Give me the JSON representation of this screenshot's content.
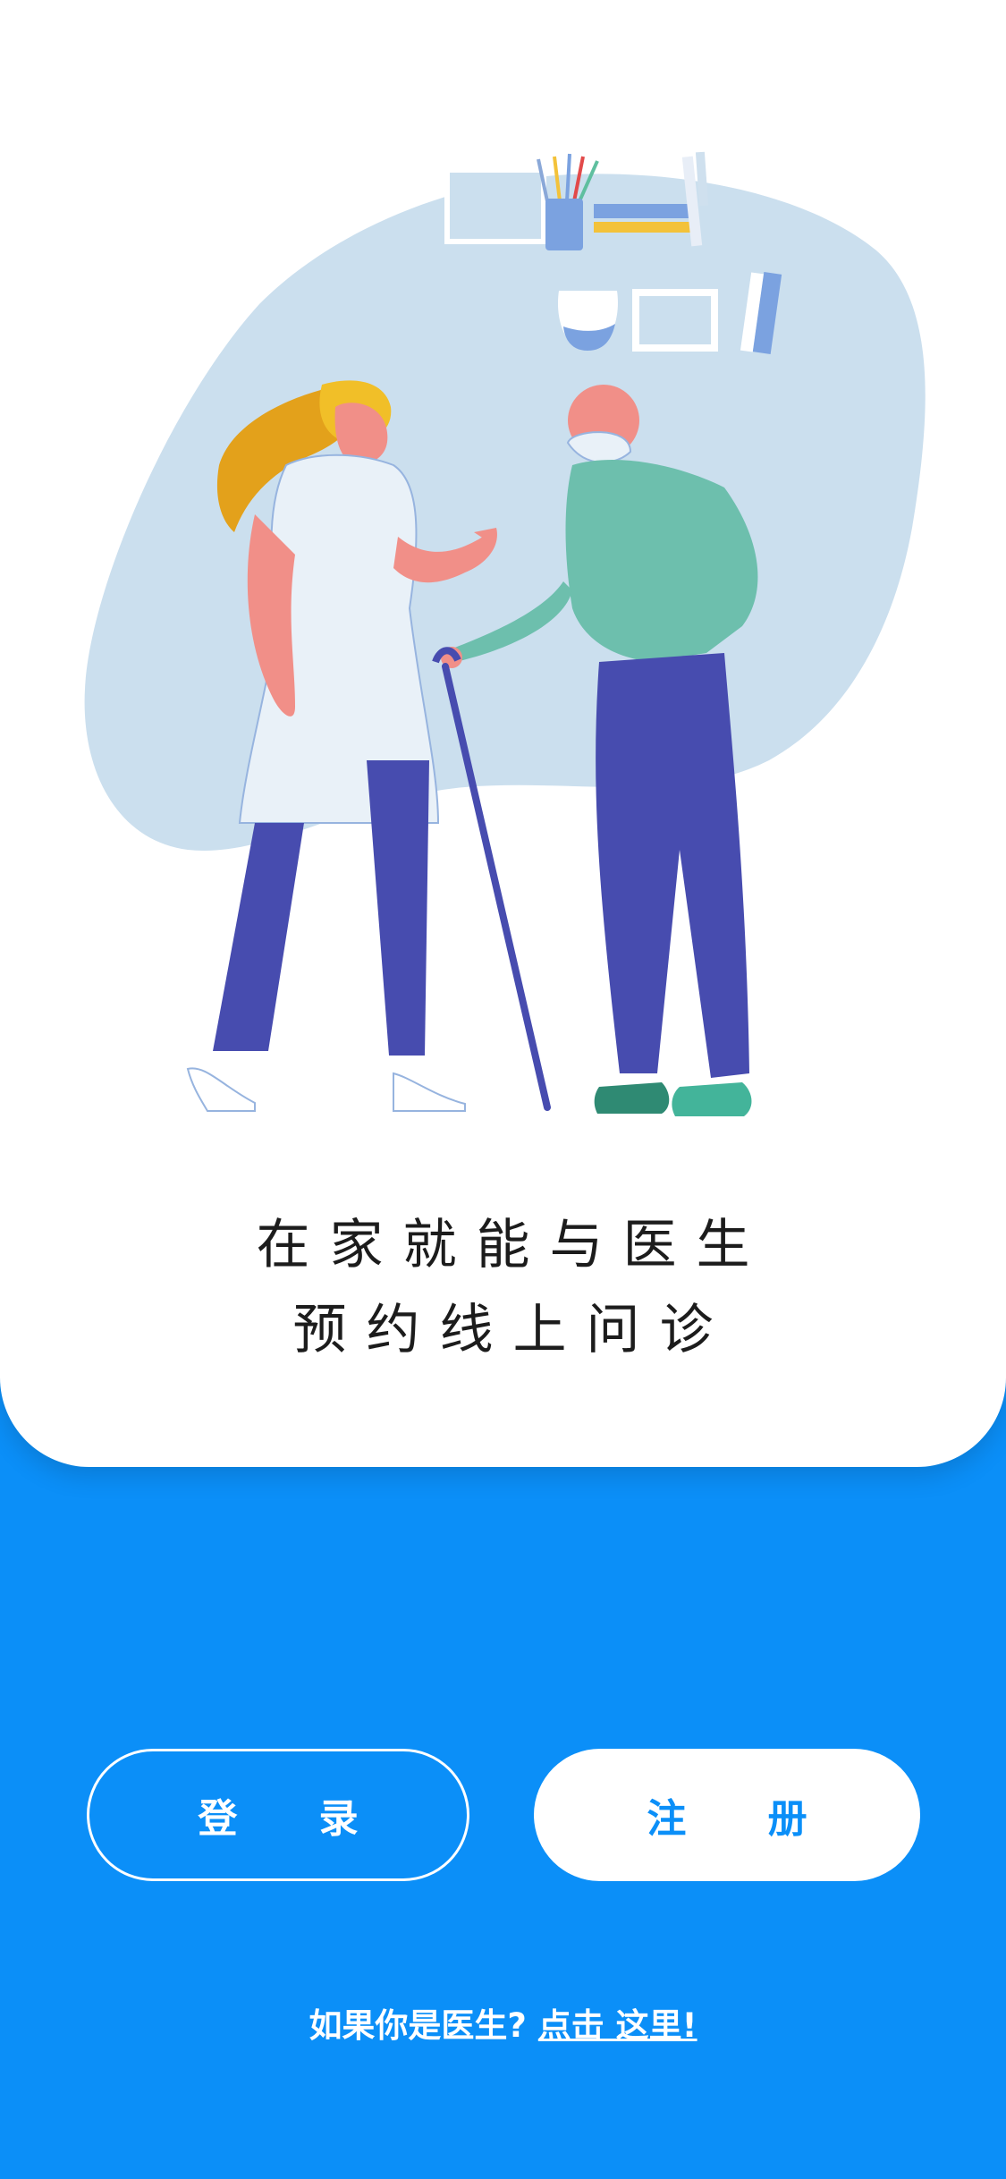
{
  "welcome": {
    "tagline_line1": "在家就能与医生",
    "tagline_line2": "预约线上问诊"
  },
  "actions": {
    "login_label": "登 录",
    "register_label": "注 册"
  },
  "footer": {
    "prompt_text": "如果你是医生?",
    "link_text": "点击 这里!"
  },
  "colors": {
    "primary": "#0b8ff8",
    "card_background": "#ffffff",
    "illustration_blob": "#cbdfee"
  },
  "illustration": {
    "icon": "doctor-patient-illustration"
  }
}
